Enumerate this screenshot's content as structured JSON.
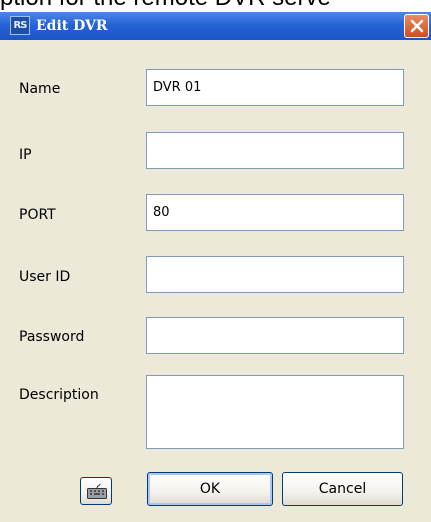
{
  "background_text": "ption for the remote DVR serve",
  "window": {
    "app_icon_text": "RS",
    "title": "Edit DVR"
  },
  "form": {
    "name": {
      "label": "Name",
      "value": "DVR 01"
    },
    "ip": {
      "label": "IP",
      "value": ""
    },
    "port": {
      "label": "PORT",
      "value": "80"
    },
    "user_id": {
      "label": "User ID",
      "value": ""
    },
    "password": {
      "label": "Password",
      "value": ""
    },
    "description": {
      "label": "Description",
      "value": ""
    }
  },
  "buttons": {
    "ok_label": "OK",
    "cancel_label": "Cancel",
    "keyboard_icon": "keyboard-icon"
  },
  "colors": {
    "titlebar": "#2563d6",
    "dialog_bg": "#ece9d8",
    "field_border": "#7f9db9",
    "close_button": "#d95a2b"
  }
}
